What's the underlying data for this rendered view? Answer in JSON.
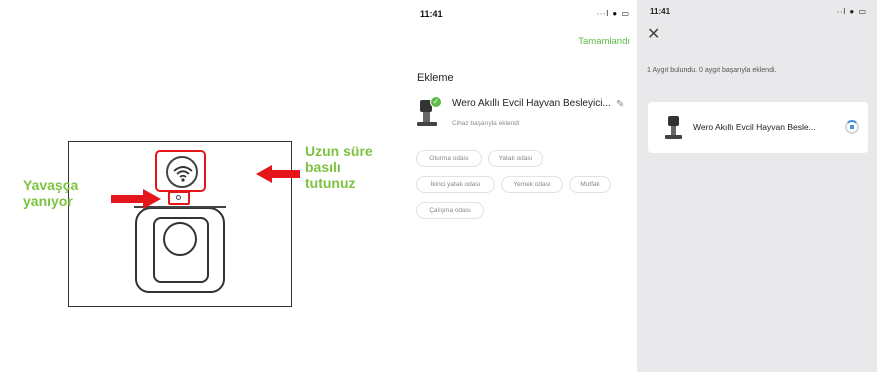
{
  "diagram": {
    "label_left": "Yavaşça yanıyor",
    "label_right": "Uzun süre basılı tutunuz",
    "accent_color": "#e4161b",
    "label_color": "#7dc241",
    "icons": [
      "wifi-icon",
      "led-indicator-icon",
      "arrow-right-icon",
      "arrow-left-icon"
    ]
  },
  "ekleme_screen": {
    "status_time": "11:41",
    "status_icons": "∙∙∙l ● ▭",
    "done_label": "Tamamlandı",
    "section_title": "Ekleme",
    "device": {
      "name": "Wero Akıllı Evcil Hayvan Besleyici...",
      "status": "Cihaz başarıyla eklendi",
      "check_icon": "check-icon",
      "edit_icon": "pencil-icon"
    },
    "rooms": [
      "Oturma odası",
      "Yatak odası",
      "İkinci yatak odası",
      "Yemek odası",
      "Mutfak",
      "Çalışma odası"
    ],
    "accent_color": "#5cba47"
  },
  "search_screen": {
    "status_time": "11:41",
    "status_icons": "∙∙l ● ▭",
    "close_icon": "close-icon",
    "found_text": "1 Aygıt bulundu. 0 aygıt başarıyla eklendi.",
    "device_name": "Wero Akıllı Evcil Hayvan Besle...",
    "spinner_color": "#4a90d9",
    "background_color": "#e9e9ec"
  }
}
